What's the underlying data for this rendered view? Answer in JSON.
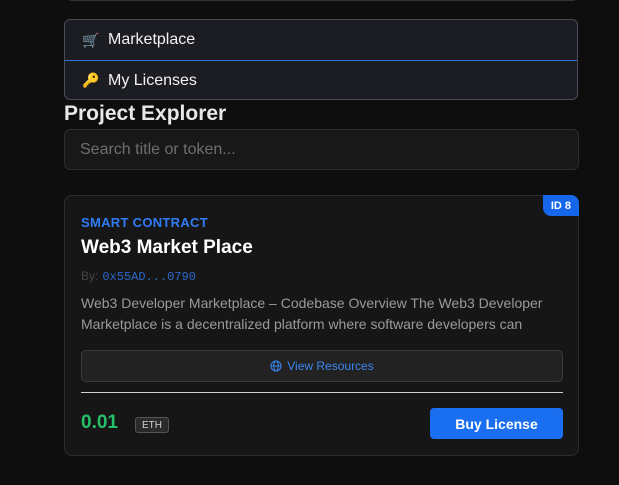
{
  "nav": {
    "items": [
      {
        "icon": "🛒",
        "icon_name": "cart-icon",
        "label": "Marketplace"
      },
      {
        "icon": "🔑",
        "icon_name": "key-icon",
        "label": "My Licenses"
      }
    ]
  },
  "explorer": {
    "title": "Project Explorer",
    "search_placeholder": "Search title or token..."
  },
  "card": {
    "id_badge": "ID 8",
    "category": "SMART CONTRACT",
    "title": "Web3 Market Place",
    "by_label": "By:",
    "author": "0x55AD...0790",
    "description": "Web3 Developer Marketplace – Codebase Overview The Web3 Developer Marketplace is a decentralized platform where software developers can submit",
    "resources_label": "View Resources",
    "resources_icon": "globe-icon",
    "price": "0.01",
    "currency": "ETH",
    "buy_label": "Buy License"
  },
  "colors": {
    "accent_blue": "#1a6ef0",
    "price_green": "#27c06a",
    "category_blue": "#2f7cf6"
  }
}
